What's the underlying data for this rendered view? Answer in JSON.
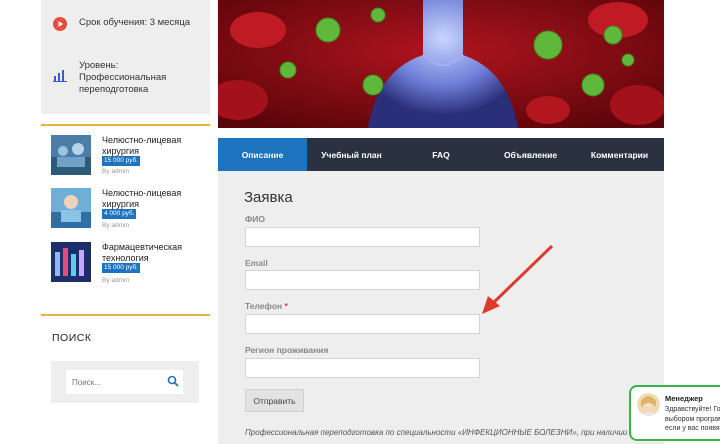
{
  "sidebar": {
    "info": [
      {
        "icon": "play-circle-icon",
        "text": "Срок обучения: 3 месяца"
      },
      {
        "icon": "bar-chart-icon",
        "text": "Уровень: Профессиональная переподготовка"
      }
    ],
    "courses": [
      {
        "title": "Челюстно-лицевая хирургия",
        "price": "15 000 руб.",
        "author": "By admin"
      },
      {
        "title": "Челюстно-лицевая хирургия",
        "price": "4 000 руб.",
        "author": "By admin"
      },
      {
        "title": "Фармацевтическая технология",
        "price": "15 000 руб.",
        "author": "By admin"
      }
    ],
    "search": {
      "title": "поиск",
      "placeholder": "Поиск..."
    }
  },
  "tabs": [
    "Описание",
    "Учебный план",
    "FAQ",
    "Объявление",
    "Комментарии"
  ],
  "form": {
    "title": "Заявка",
    "fields": [
      {
        "label": "ФИО",
        "required": false
      },
      {
        "label": "Email",
        "required": false
      },
      {
        "label": "Телефон",
        "required": true
      },
      {
        "label": "Регион проживания",
        "required": false
      }
    ],
    "submit": "Отправить",
    "note": "Профессиональная переподготовка по специальности «ИНФЕКЦИОННЫЕ БОЛЕЗНИ»,  при наличии"
  },
  "chat": {
    "name": "Менеджер",
    "lines": [
      "Здравствуйте! Гото",
      "выбором программ",
      "если у вас появят"
    ]
  },
  "colors": {
    "accent": "#1e73be",
    "tabs_bg": "#2a3242",
    "gold": "#e6b43c",
    "chat_border": "#3cb34a",
    "arrow": "#e03a2e"
  }
}
